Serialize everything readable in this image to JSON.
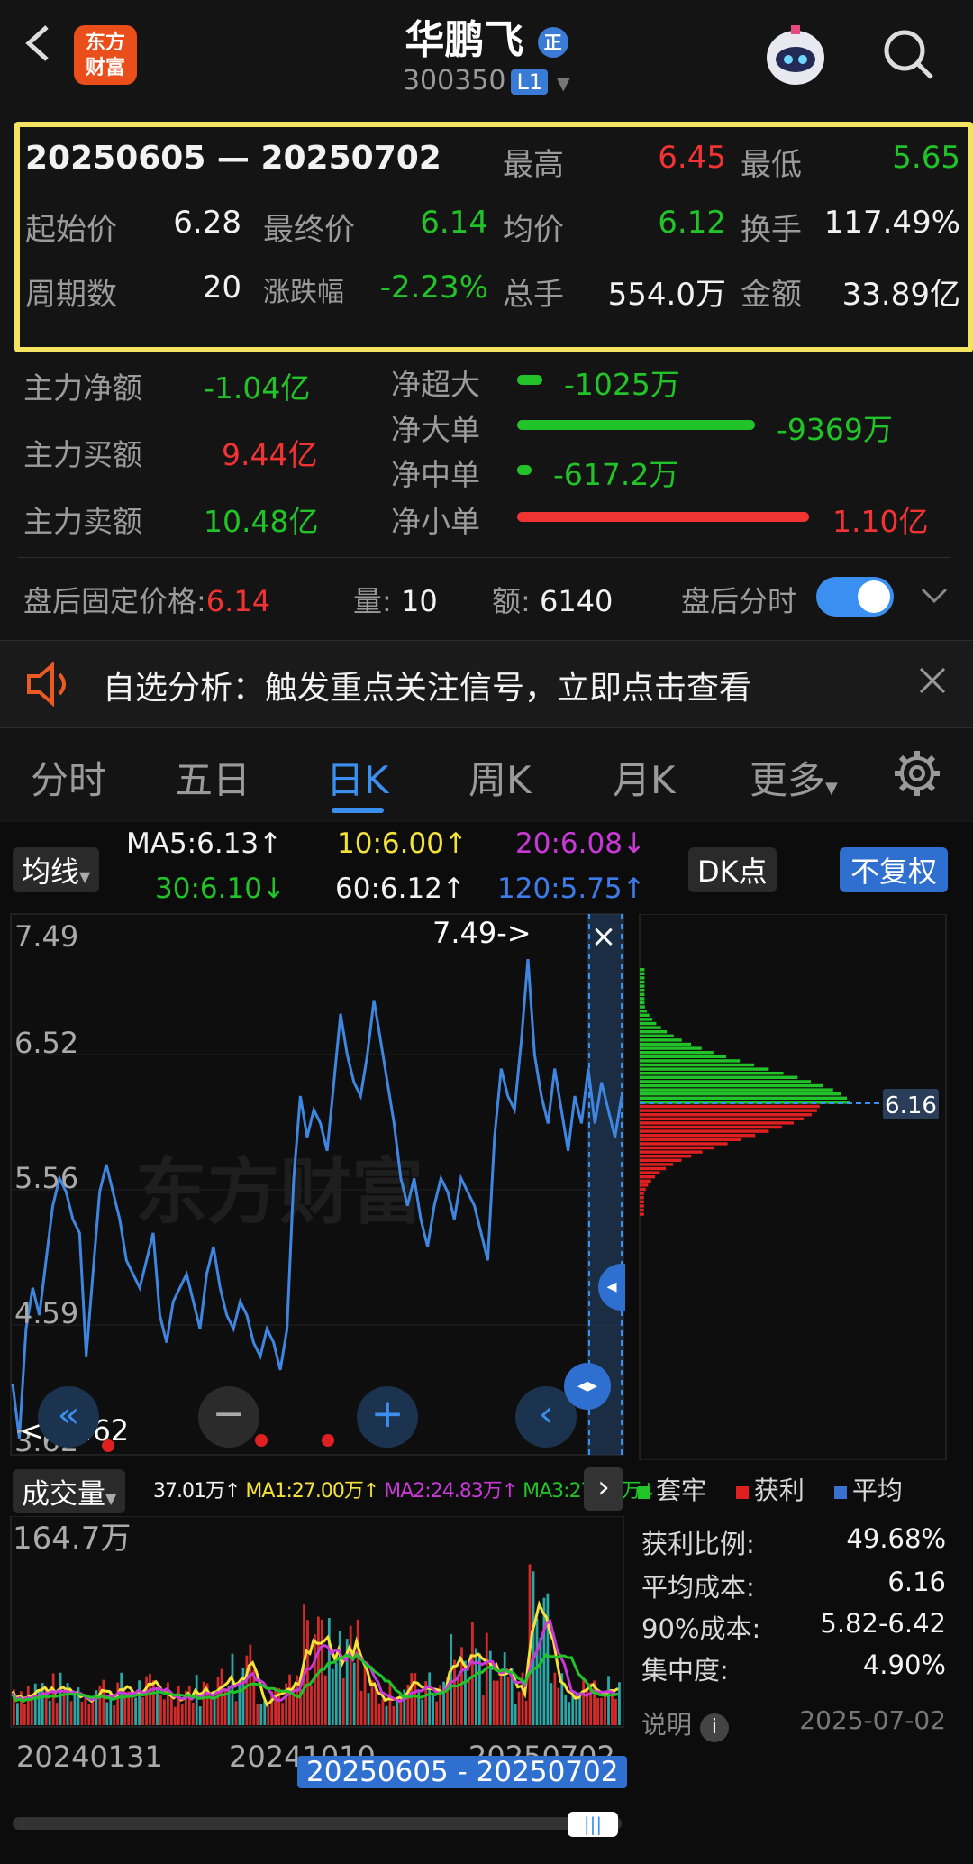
{
  "header": {
    "stock_name": "华鹏飞",
    "code": "300350",
    "level": "L1",
    "badge": "正",
    "logo_line1": "东方",
    "logo_line2": "财富"
  },
  "summary": {
    "range": "20250605 — 20250702",
    "high_label": "最高",
    "high": "6.45",
    "low_label": "最低",
    "low": "5.65",
    "open_label": "起始价",
    "open": "6.28",
    "close_label": "最终价",
    "close": "6.14",
    "avg_label": "均价",
    "avg": "6.12",
    "turnover_label": "换手",
    "turnover": "117.49%",
    "periods_label": "周期数",
    "periods": "20",
    "change_label": "涨跌幅",
    "change": "-2.23%",
    "volume_label": "总手",
    "volume": "554.0万",
    "amount_label": "金额",
    "amount": "33.89亿"
  },
  "flows": {
    "main_net_label": "主力净额",
    "main_net": "-1.04亿",
    "main_buy_label": "主力买额",
    "main_buy": "9.44亿",
    "main_sell_label": "主力卖额",
    "main_sell": "10.48亿",
    "xl_label": "净超大",
    "xl": "-1025万",
    "l_label": "净大单",
    "l": "-9369万",
    "m_label": "净中单",
    "m": "-617.2万",
    "s_label": "净小单",
    "s": "1.10亿"
  },
  "after_hours": {
    "price_label": "盘后固定价格:",
    "price": "6.14",
    "qty_label": "量:",
    "qty": "10",
    "amt_label": "额:",
    "amt": "6140",
    "toggle_label": "盘后分时",
    "toggle_on": true
  },
  "notice": {
    "text": "自选分析：触发重点关注信号，立即点击查看"
  },
  "tabs": [
    "分时",
    "五日",
    "日K",
    "周K",
    "月K",
    "更多"
  ],
  "active_tab": "日K",
  "ma_bar": {
    "selector": "均线",
    "ma5": "MA5:6.13↑",
    "ma10": "10:6.00↑",
    "ma20": "20:6.08↓",
    "ma30": "30:6.10↓",
    "ma60": "60:6.12↑",
    "ma120": "120:5.75↑",
    "dk_button": "DK点",
    "adjust_button": "不复权"
  },
  "price_chart": {
    "y_labels": [
      "7.49",
      "6.52",
      "5.56",
      "4.59",
      "3.62"
    ],
    "max_marker": "7.49->",
    "min_marker": "<--3.62",
    "watermark": "东方财富",
    "cost_label": "6.16"
  },
  "chart_data": [
    {
      "type": "line",
      "ylim": [
        3.62,
        7.49
      ],
      "y_ticks": [
        7.49,
        6.52,
        5.56,
        4.59,
        3.62
      ],
      "series": [
        {
          "values": [
            4.1,
            3.7,
            4.5,
            4.8,
            4.6,
            5.0,
            5.4,
            5.6,
            5.5,
            5.3,
            5.2,
            4.3,
            4.9,
            5.5,
            5.7,
            5.5,
            5.3,
            5.0,
            4.9,
            4.8,
            5.0,
            5.2,
            4.6,
            4.4,
            4.7,
            4.8,
            4.9,
            4.7,
            4.5,
            4.9,
            5.1,
            4.8,
            4.6,
            4.5,
            4.7,
            4.6,
            4.4,
            4.3,
            4.5,
            4.4,
            4.2,
            4.5,
            5.6,
            6.2,
            5.9,
            6.1,
            6.0,
            5.8,
            6.3,
            6.8,
            6.5,
            6.3,
            6.2,
            6.5,
            6.9,
            6.6,
            6.3,
            6.0,
            5.6,
            5.4,
            5.6,
            5.3,
            5.1,
            5.4,
            5.6,
            5.5,
            5.3,
            5.6,
            5.5,
            5.4,
            5.2,
            5.0,
            5.9,
            6.4,
            6.2,
            6.1,
            6.6,
            7.2,
            6.5,
            6.2,
            6.0,
            6.4,
            6.1,
            5.8,
            6.2,
            6.0,
            6.4,
            6.0,
            6.3,
            6.1,
            5.9,
            6.2
          ]
        }
      ]
    },
    {
      "type": "bar",
      "title": "成交量",
      "ylim": [
        0,
        164.7
      ],
      "legend": [
        "37.01万↑",
        "MA1:27.00万↑",
        "MA2:24.83万↑",
        "MA3:27.70万↓"
      ],
      "x_labels": [
        "20240131",
        "20241010",
        "20250702"
      ],
      "selection": "20250605 - 20250702",
      "y_label": "164.7万"
    }
  ],
  "chip_distribution": {
    "legend": [
      "套牢",
      "获利",
      "平均"
    ],
    "profit_ratio_label": "获利比例:",
    "profit_ratio": "49.68%",
    "avg_cost_label": "平均成本:",
    "avg_cost": "6.16",
    "cost90_label": "90%成本:",
    "cost90": "5.82-6.42",
    "concentration_label": "集中度:",
    "concentration": "4.90%",
    "note_label": "说明",
    "date": "2025-07-02"
  },
  "colors": {
    "up": "#f23333",
    "down": "#22c329",
    "accent": "#3b8ff0",
    "highlight": "#f4e462"
  }
}
